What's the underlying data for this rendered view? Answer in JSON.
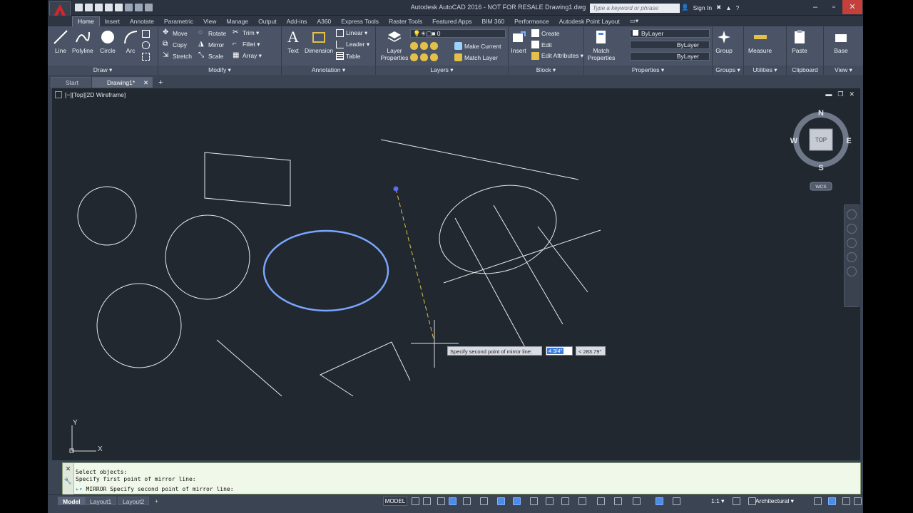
{
  "app": {
    "title": "Autodesk AutoCAD 2016 - NOT FOR RESALE    Drawing1.dwg",
    "search_placeholder": "Type a keyword or phrase",
    "signin": "Sign In"
  },
  "ribbon_tabs": [
    "Home",
    "Insert",
    "Annotate",
    "Parametric",
    "View",
    "Manage",
    "Output",
    "Add-ins",
    "A360",
    "Express Tools",
    "Raster Tools",
    "Featured Apps",
    "BIM 360",
    "Performance",
    "Autodesk Point Layout"
  ],
  "panels": {
    "draw": {
      "label": "Draw ▾",
      "buttons": [
        "Line",
        "Polyline",
        "Circle",
        "Arc"
      ]
    },
    "modify": {
      "label": "Modify ▾",
      "rows": [
        [
          "Move",
          "Rotate",
          "Trim ▾"
        ],
        [
          "Copy",
          "Mirror",
          "Fillet ▾"
        ],
        [
          "Stretch",
          "Scale",
          "Array ▾"
        ]
      ]
    },
    "annotation": {
      "label": "Annotation ▾",
      "big": [
        "Text",
        "Dimension"
      ],
      "small": [
        "Linear ▾",
        "Leader ▾",
        "Table"
      ]
    },
    "layers": {
      "label": "Layers ▾",
      "big": "Layer Properties",
      "current_layer": "0",
      "small": [
        "Make Current",
        "Match Layer"
      ]
    },
    "block": {
      "label": "Block ▾",
      "big": "Insert",
      "small": [
        "Create",
        "Edit",
        "Edit Attributes ▾"
      ]
    },
    "properties": {
      "label": "Properties ▾",
      "big": "Match Properties",
      "color": "ByLayer",
      "linetype": "ByLayer",
      "lineweight": "ByLayer"
    },
    "groups": {
      "label": "Groups ▾",
      "big": "Group"
    },
    "utilities": {
      "label": "Utilities ▾",
      "big": "Measure"
    },
    "clipboard": {
      "label": "Clipboard",
      "big": "Paste"
    },
    "view": {
      "label": "View ▾",
      "big": "Base"
    }
  },
  "file_tabs": [
    "Start",
    "Drawing1*"
  ],
  "viewport": {
    "label": "[−][Top][2D Wireframe]",
    "viewcube": {
      "face": "TOP",
      "n": "N",
      "s": "S",
      "e": "E",
      "w": "W",
      "ucs": "WCS"
    },
    "ucs_x": "X",
    "ucs_y": "Y"
  },
  "tooltip": {
    "prompt": "Specify second point of mirror line:",
    "value1": "4 3/4\"",
    "value2": "< 283.79°"
  },
  "command": {
    "history": [
      "Select objects:",
      "Specify first point of mirror line:"
    ],
    "current": "MIRROR Specify second point of mirror line:"
  },
  "status": {
    "layout_tabs": [
      "Model",
      "Layout1",
      "Layout2"
    ],
    "add": "+",
    "model": "MODEL",
    "scale": "1:1 ▾",
    "units": "Architectural ▾"
  },
  "colors": {
    "accent": "#4d8be4",
    "selection": "#7aa6ff",
    "canvas": "#212830"
  }
}
